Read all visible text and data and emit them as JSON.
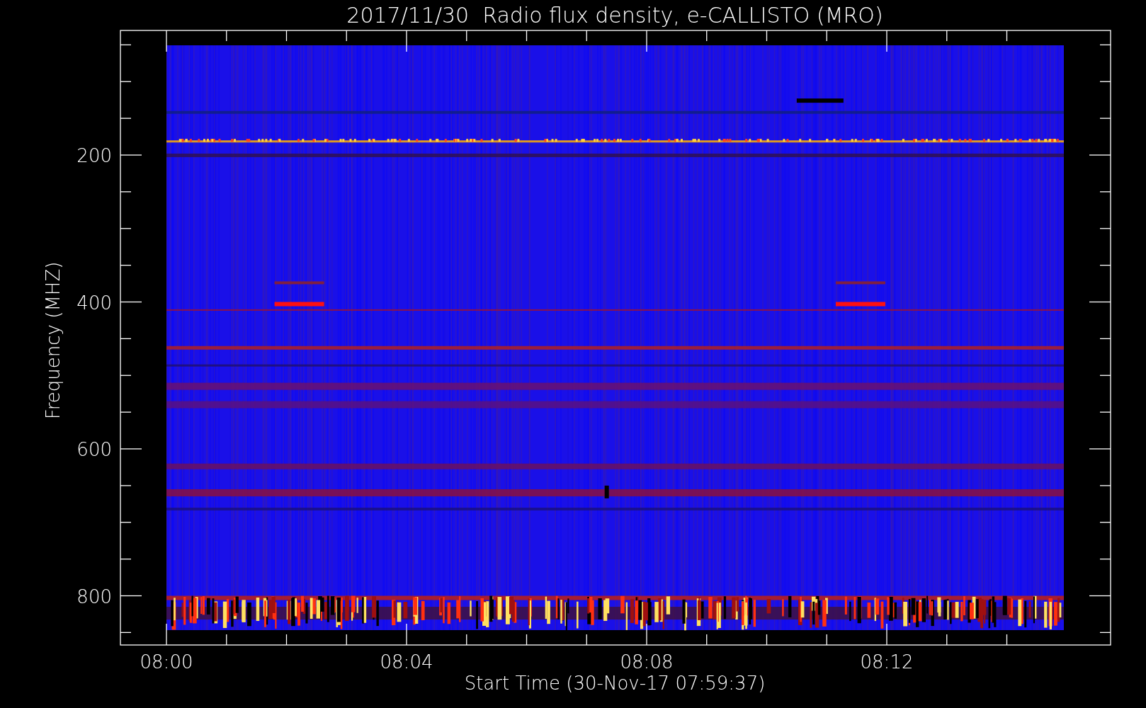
{
  "title": "2017/11/30  Radio flux density, e-CALLISTO (MRO)",
  "y_axis": {
    "label": "Frequency (MHZ)",
    "ticks": [
      "200",
      "400",
      "600",
      "800"
    ]
  },
  "x_axis": {
    "label": "Start Time (30-Nov-17 07:59:37)",
    "ticks": [
      "08:00",
      "08:04",
      "08:08",
      "08:12"
    ]
  }
}
